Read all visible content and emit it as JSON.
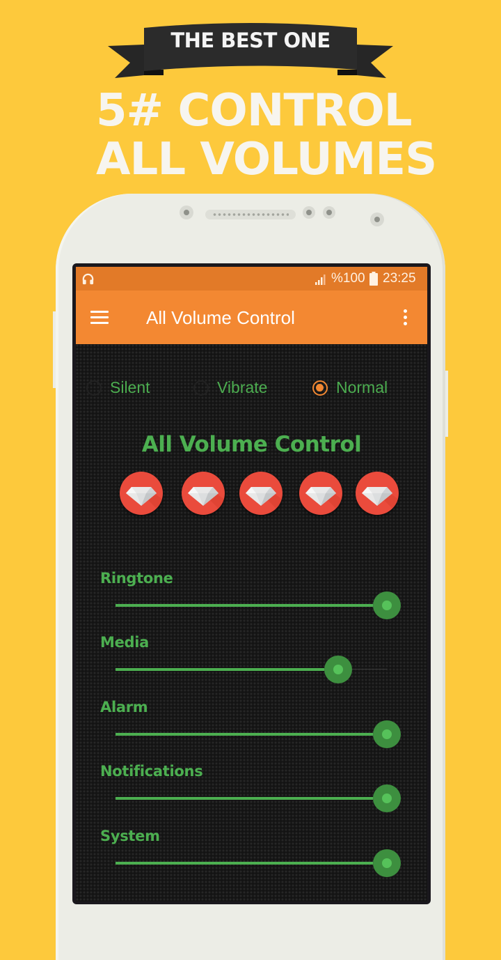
{
  "promo": {
    "banner_text": "THE BEST ONE",
    "headline_line1": "5# CONTROL",
    "headline_line2": "ALL VOLUMES"
  },
  "status_bar": {
    "left_icon": "headphones-icon",
    "signal_icon": "signal-icon",
    "battery_text": "%100",
    "battery_icon": "battery-icon",
    "time": "23:25"
  },
  "app_bar": {
    "menu_icon": "hamburger-menu-icon",
    "title": "All Volume Control",
    "more_icon": "more-vert-icon"
  },
  "ringer_modes": {
    "options": [
      {
        "label": "Silent",
        "checked": false
      },
      {
        "label": "Vibrate",
        "checked": false
      },
      {
        "label": "Normal",
        "checked": true
      }
    ]
  },
  "main": {
    "title": "All Volume Control",
    "gem_buttons": [
      {
        "icon": "diamond-icon"
      },
      {
        "icon": "diamond-icon"
      },
      {
        "icon": "diamond-icon"
      },
      {
        "icon": "diamond-icon"
      },
      {
        "icon": "diamond-icon"
      }
    ],
    "volumes": [
      {
        "label": "Ringtone",
        "level_percent": 100
      },
      {
        "label": "Media",
        "level_percent": 82
      },
      {
        "label": "Alarm",
        "level_percent": 100
      },
      {
        "label": "Notifications",
        "level_percent": 100
      },
      {
        "label": "System",
        "level_percent": 100
      }
    ]
  },
  "colors": {
    "background": "#fdc93c",
    "app_bar": "#f38832",
    "status_bar": "#e27a28",
    "accent_green": "#4caf50",
    "gem_red": "#ea4b3c"
  }
}
